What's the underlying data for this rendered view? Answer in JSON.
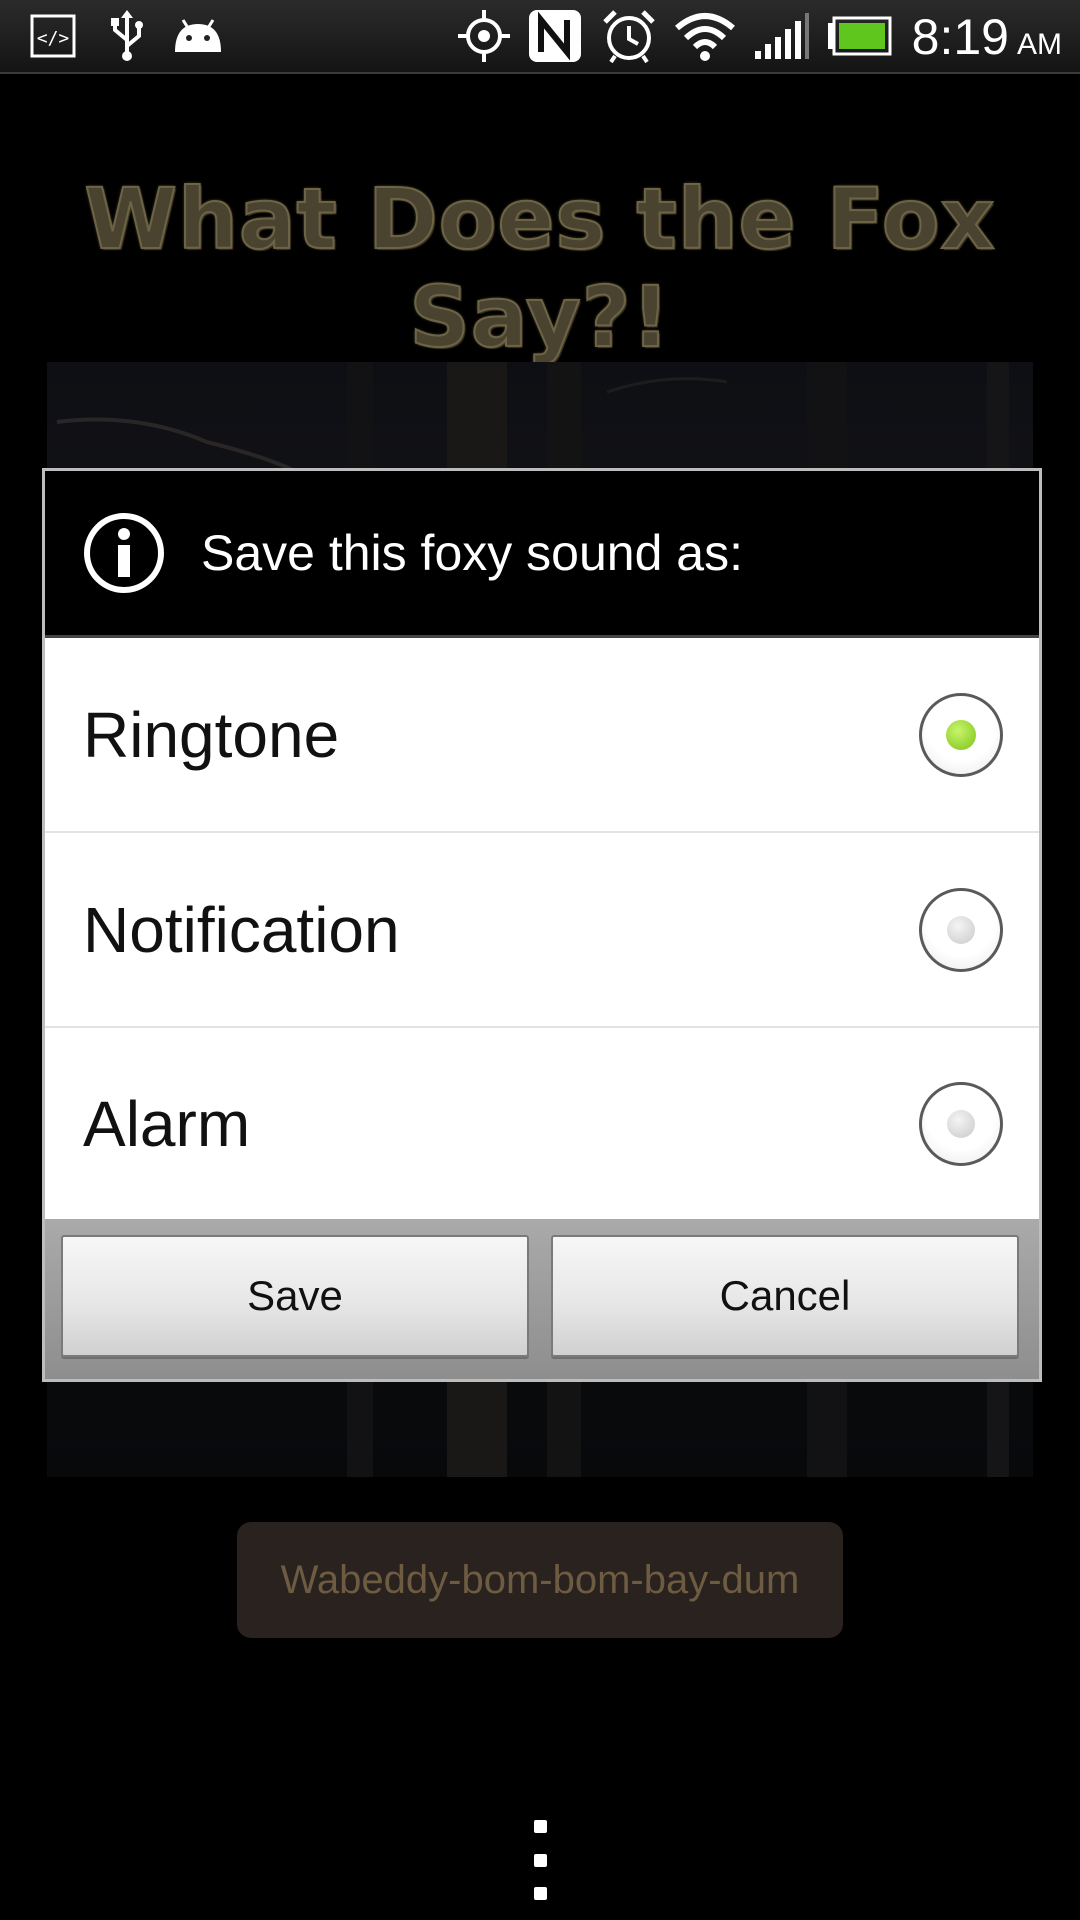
{
  "status_bar": {
    "time": "8:19",
    "ampm": "AM",
    "icons": [
      "code-icon",
      "usb-icon",
      "android-debug-icon",
      "gps-icon",
      "nfc-icon",
      "alarm-icon",
      "wifi-icon",
      "signal-icon",
      "battery-icon"
    ],
    "battery_color": "#5ec61d"
  },
  "app": {
    "title": "What Does the Fox Say?!",
    "sound_button_label": "Wabeddy-bom-bom-bay-dum"
  },
  "dialog": {
    "title": "Save this foxy sound as:",
    "options": [
      {
        "label": "Ringtone",
        "selected": true
      },
      {
        "label": "Notification",
        "selected": false
      },
      {
        "label": "Alarm",
        "selected": false
      }
    ],
    "save_label": "Save",
    "cancel_label": "Cancel",
    "accent": "#7cc21b"
  }
}
